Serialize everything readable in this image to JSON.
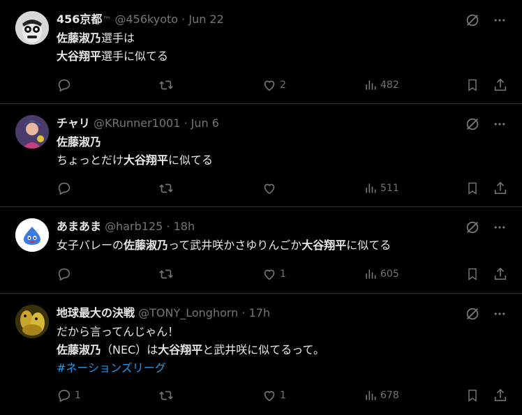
{
  "tweets": [
    {
      "name": "456京都",
      "badge": "™",
      "handle": "@456kyoto",
      "sep": "·",
      "time": "Jun 22",
      "line1_b": "佐藤淑乃",
      "line1_t": "選手は",
      "line2_b": "大谷翔平",
      "line2_t": "選手に似てる",
      "replies": "",
      "retweets": "",
      "likes": "2",
      "views": "482"
    },
    {
      "name": "チャリ",
      "handle": "@KRunner1001",
      "sep": "·",
      "time": "Jun 6",
      "line1_b": "佐藤淑乃",
      "line2_t": "ちょっとだけ",
      "line2_b": "大谷翔平",
      "line2_t2": "に似てる",
      "replies": "",
      "retweets": "",
      "likes": "",
      "views": "511"
    },
    {
      "name": "あまあま",
      "handle": "@harb125",
      "sep": "·",
      "time": "18h",
      "line1_t": "女子バレーの",
      "line1_b": "佐藤淑乃",
      "line1_t2": "って武井咲かさゆりんごか",
      "line1_b2": "大谷翔平",
      "line1_t3": "に似てる",
      "replies": "",
      "retweets": "",
      "likes": "1",
      "views": "605"
    },
    {
      "name": "地球最大の決戦",
      "handle": "@TONY_Longhorn",
      "sep": "·",
      "time": "17h",
      "line1_t": "だから言ってんじゃん！",
      "line2_b": "佐藤淑乃",
      "line2_t": "（NEC）は",
      "line2_b2": "大谷翔平",
      "line2_t2": "と武井咲に似てるって。",
      "hashtag": "#ネーションズリーグ",
      "replies": "1",
      "retweets": "",
      "likes": "1",
      "views": "678"
    }
  ],
  "colors": {
    "background": "#000000",
    "text": "#e7e9ea",
    "muted": "#71767b",
    "link": "#1d9bf0",
    "divider": "#2f3336"
  },
  "icons": [
    "grok-icon",
    "more-icon",
    "reply-icon",
    "retweet-icon",
    "like-icon",
    "views-icon",
    "bookmark-icon",
    "share-icon"
  ]
}
